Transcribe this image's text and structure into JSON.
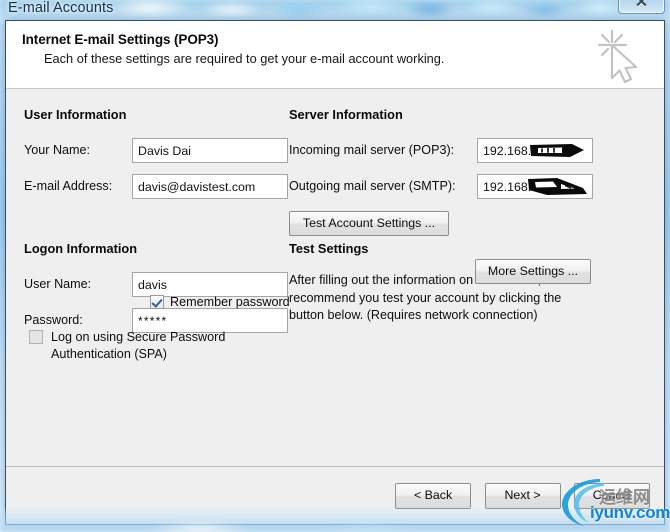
{
  "window": {
    "title": "E-mail Accounts",
    "close_label": "✕"
  },
  "header": {
    "title": "Internet E-mail Settings (POP3)",
    "subtitle": "Each of these settings are required to get your e-mail account working.",
    "icon": "cursor-sparkle-icon"
  },
  "user_information": {
    "group_title": "User Information",
    "fields": [
      {
        "label": "Your Name:",
        "value": "Davis Dai"
      },
      {
        "label": "E-mail Address:",
        "value": "davis@davistest.com"
      }
    ]
  },
  "logon_information": {
    "group_title": "Logon Information",
    "fields": [
      {
        "label": "User Name:",
        "value": "davis"
      },
      {
        "label": "Password:",
        "value": "*****"
      }
    ],
    "remember_password": {
      "label": "Remember password",
      "checked": true
    },
    "spa": {
      "label": "Log on using Secure Password Authentication (SPA)",
      "line1": "Log on using Secure Password",
      "line2": "Authentication (SPA)",
      "checked": false
    }
  },
  "server_information": {
    "group_title": "Server Information",
    "fields": [
      {
        "label": "Incoming mail server (POP3):",
        "value": "192.168.",
        "redacted": true
      },
      {
        "label": "Outgoing mail server (SMTP):",
        "value": "192.168.",
        "redacted": true
      }
    ]
  },
  "test_settings": {
    "group_title": "Test Settings",
    "description": "After filling out the information on this screen, we recommend you test your account by clicking the button below. (Requires network connection)",
    "test_button": "Test Account Settings ...",
    "more_button": "More Settings ..."
  },
  "footer": {
    "back": "< Back",
    "next": "Next >",
    "cancel": "Cancel"
  },
  "watermark": {
    "cn": "运维网",
    "en": "iyunv.com",
    "accent": "#1485d6"
  }
}
